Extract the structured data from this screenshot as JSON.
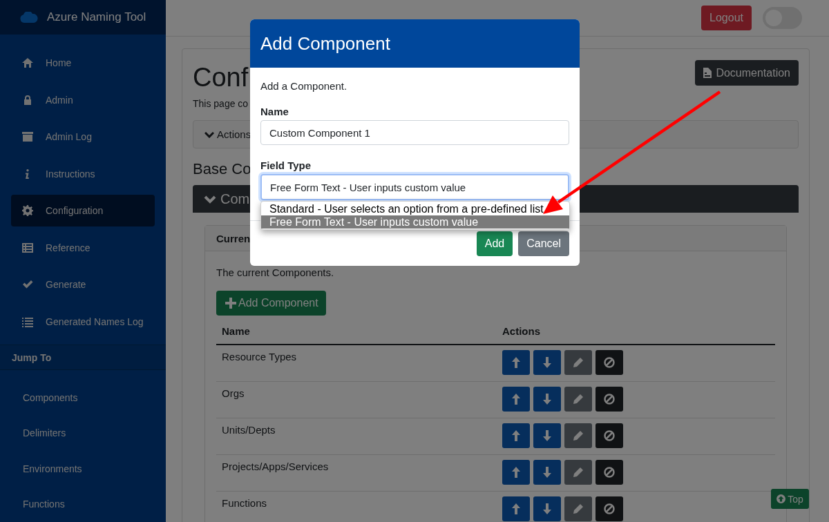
{
  "app_title": "Azure Naming Tool",
  "sidebar": {
    "nav": [
      {
        "label": "Home",
        "selected": false
      },
      {
        "label": "Admin",
        "selected": false
      },
      {
        "label": "Admin Log",
        "selected": false
      },
      {
        "label": "Instructions",
        "selected": false
      },
      {
        "label": "Configuration",
        "selected": true
      },
      {
        "label": "Reference",
        "selected": false
      },
      {
        "label": "Generate",
        "selected": false
      },
      {
        "label": "Generated Names Log",
        "selected": false
      }
    ],
    "jump_to": {
      "title": "Jump To",
      "items": [
        "Components",
        "Delimiters",
        "Environments",
        "Functions"
      ]
    }
  },
  "header": {
    "logout": "Logout",
    "theme_toggle": {
      "on": false
    }
  },
  "page": {
    "title": "Conf",
    "description": "This page co",
    "documentation": "Documentation",
    "actions_panel": "Actions",
    "section_heading": "Base Co",
    "components_panel": "Com",
    "card_header": "Curren",
    "card_text": "The current Components.",
    "add_button": "Add Component",
    "table": {
      "columns": [
        "Name",
        "Actions"
      ],
      "rows": [
        "Resource Types",
        "Orgs",
        "Units/Depts",
        "Projects/Apps/Services",
        "Functions"
      ]
    }
  },
  "top_button": "Top",
  "modal": {
    "title": "Add Component",
    "intro": "Add a Component.",
    "name_label": "Name",
    "name_value": "Custom Component 1",
    "field_type_label": "Field Type",
    "field_type_value": "Free Form Text - User inputs custom value",
    "options": [
      {
        "label": "Standard - User selects an option from a pre-defined list",
        "selected": false
      },
      {
        "label": "Free Form Text - User inputs custom value",
        "selected": true
      }
    ],
    "buttons": [
      "Add",
      "Cancel"
    ]
  }
}
